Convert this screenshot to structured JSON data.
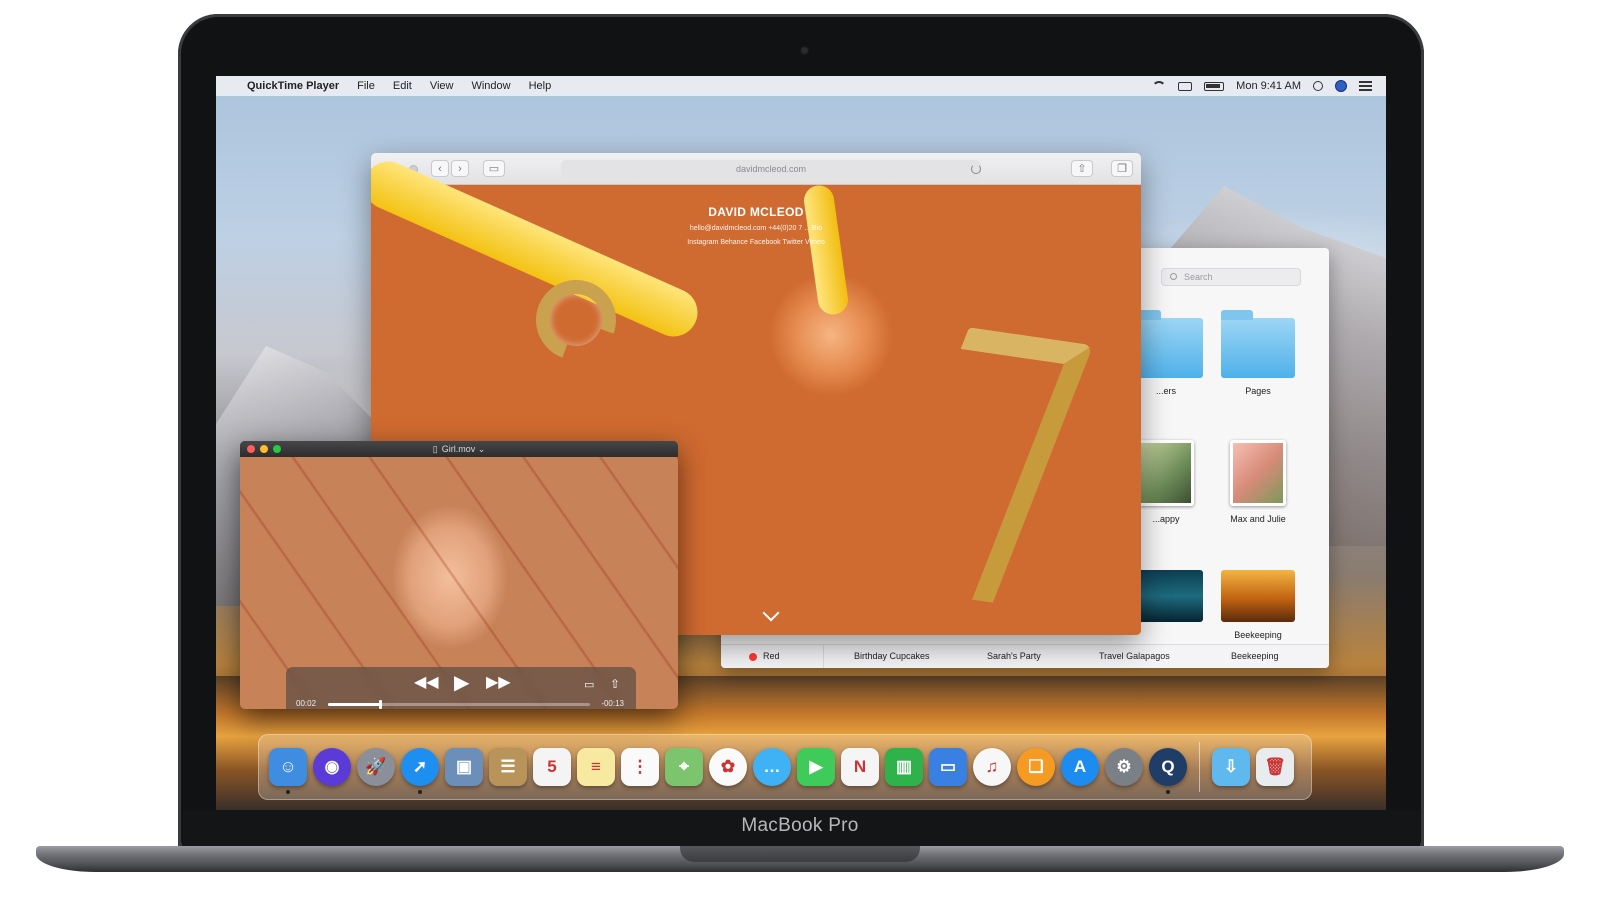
{
  "device": {
    "brand_label": "MacBook Pro"
  },
  "menubar": {
    "apple_glyph": "",
    "app_name": "QuickTime Player",
    "items": [
      "File",
      "Edit",
      "View",
      "Window",
      "Help"
    ],
    "clock": "Mon 9:41 AM"
  },
  "safari": {
    "address": "davidmcleod.com",
    "page_heading": "DAVID MCLEOD",
    "page_contact": "hello@davidmcleod.com   +44(0)20 7 ...   Bio",
    "page_links": "Instagram   Behance   Facebook   Twitter   Vimeo"
  },
  "finder": {
    "search_placeholder": "Search",
    "items": [
      {
        "label": "...ers",
        "kind": "folder"
      },
      {
        "label": "Pages",
        "kind": "folder"
      },
      {
        "label": "...appy",
        "kind": "photo"
      },
      {
        "label": "Max and Julie",
        "kind": "photo"
      },
      {
        "label": "",
        "kind": "dark"
      },
      {
        "label": "Beekeeping",
        "kind": "honey"
      }
    ],
    "tags": [
      "Red",
      "Birthday Cupcakes",
      "Sarah's Party",
      "Travel Galapagos",
      "Beekeeping"
    ]
  },
  "quicktime": {
    "title": "Girl.mov ⌄",
    "time_elapsed": "00:02",
    "time_remaining": "-00:13",
    "progress": 0.2
  },
  "dock": {
    "apps": [
      {
        "name": "finder-icon",
        "color": "#3f8de0",
        "glyph": "☺",
        "running": true
      },
      {
        "name": "siri-icon",
        "color": "#5b3bd8",
        "glyph": "◉",
        "running": false,
        "round": true
      },
      {
        "name": "launchpad-icon",
        "color": "#8a8f99",
        "glyph": "🚀",
        "running": false,
        "round": true
      },
      {
        "name": "safari-icon",
        "color": "#1e8ef0",
        "glyph": "➚",
        "running": true,
        "round": true
      },
      {
        "name": "photo-browser-icon",
        "color": "#6b8fb8",
        "glyph": "▣",
        "running": false
      },
      {
        "name": "contacts-icon",
        "color": "#b8935a",
        "glyph": "☰",
        "running": false
      },
      {
        "name": "calendar-icon",
        "color": "#f4f4f4",
        "glyph": "5",
        "running": false
      },
      {
        "name": "notes-icon",
        "color": "#f8e9a1",
        "glyph": "≡",
        "running": false
      },
      {
        "name": "reminders-icon",
        "color": "#fafafa",
        "glyph": "⋮",
        "running": false
      },
      {
        "name": "maps-icon",
        "color": "#7cc46e",
        "glyph": "⌖",
        "running": false
      },
      {
        "name": "photos-icon",
        "color": "#fafafa",
        "glyph": "✿",
        "running": false,
        "round": true
      },
      {
        "name": "messages-icon",
        "color": "#3fb2f5",
        "glyph": "…",
        "running": false,
        "round": true
      },
      {
        "name": "facetime-icon",
        "color": "#3fcb5a",
        "glyph": "▶",
        "running": false
      },
      {
        "name": "news-icon",
        "color": "#f5f5f5",
        "glyph": "N",
        "running": false
      },
      {
        "name": "numbers-icon",
        "color": "#2fb24c",
        "glyph": "▥",
        "running": false
      },
      {
        "name": "keynote-icon",
        "color": "#3a80e2",
        "glyph": "▭",
        "running": false
      },
      {
        "name": "itunes-icon",
        "color": "#f7f7f7",
        "glyph": "♫",
        "running": false,
        "round": true
      },
      {
        "name": "ibooks-icon",
        "color": "#f59a23",
        "glyph": "❑",
        "running": false,
        "round": true
      },
      {
        "name": "app-store-icon",
        "color": "#1d8cf0",
        "glyph": "A",
        "running": false,
        "round": true
      },
      {
        "name": "system-preferences-icon",
        "color": "#7b7f86",
        "glyph": "⚙",
        "running": false,
        "round": true
      },
      {
        "name": "quicktime-icon",
        "color": "#1f3d66",
        "glyph": "Q",
        "running": true,
        "round": true
      },
      {
        "name": "downloads-folder-icon",
        "color": "#5fb8ee",
        "glyph": "⇩",
        "running": false,
        "divider_before": true
      },
      {
        "name": "trash-icon",
        "color": "#e8ecef",
        "glyph": "🗑",
        "running": false
      }
    ]
  }
}
